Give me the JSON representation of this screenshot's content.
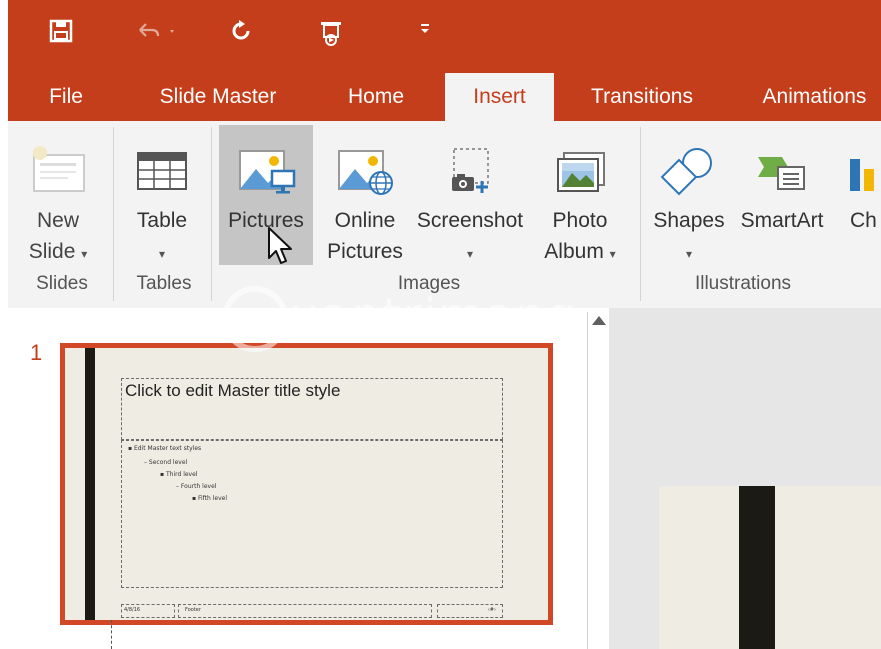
{
  "quick_access": {
    "save_icon": "save-icon",
    "undo_icon": "undo-icon",
    "redo_icon": "redo-icon",
    "present_icon": "start-from-beginning-icon",
    "customize_icon": "customize-toolbar-icon"
  },
  "tabs": [
    {
      "label": "File",
      "active": false
    },
    {
      "label": "Slide Master",
      "active": false
    },
    {
      "label": "Home",
      "active": false
    },
    {
      "label": "Insert",
      "active": true
    },
    {
      "label": "Transitions",
      "active": false
    },
    {
      "label": "Animations",
      "active": false
    }
  ],
  "ribbon": {
    "groups": {
      "slides": "Slides",
      "tables": "Tables",
      "images": "Images",
      "illustrations": "Illustrations"
    },
    "buttons": {
      "new_slide_line1": "New",
      "new_slide_line2": "Slide",
      "table": "Table",
      "pictures": "Pictures",
      "online_pictures_line1": "Online",
      "online_pictures_line2": "Pictures",
      "screenshot": "Screenshot",
      "photo_album_line1": "Photo",
      "photo_album_line2": "Album",
      "shapes": "Shapes",
      "smartart": "SmartArt",
      "chart_partial": "Ch"
    },
    "dropdown_caret": "▾"
  },
  "thumbnail_pane": {
    "slide_number": "1",
    "title_placeholder": "Click to edit Master title style",
    "bullet_levels": [
      "Edit Master text styles",
      "Second level",
      "Third level",
      "Fourth level",
      "Fifth level"
    ],
    "footer_date": "4/8/16",
    "footer_text": "Footer",
    "footer_num": "‹#›"
  },
  "watermark": "uantrimang",
  "colors": {
    "accent": "#c43e1c",
    "ribbon_bg": "#f3f3f3",
    "selection_border": "#d24726"
  }
}
